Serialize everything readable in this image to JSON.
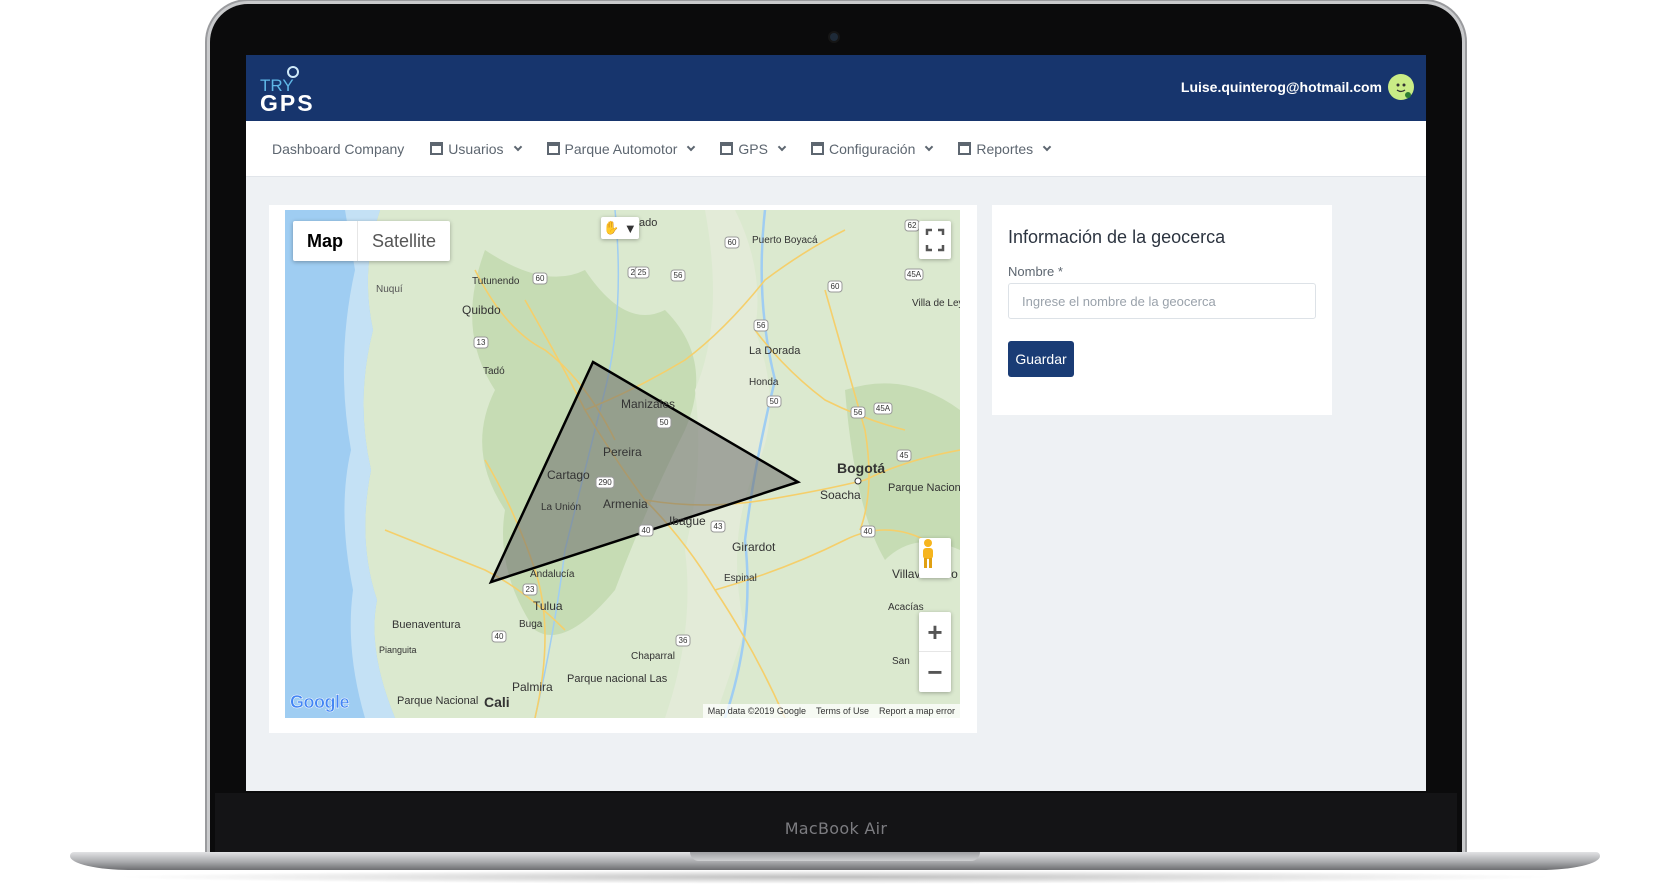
{
  "device": {
    "label": "MacBook Air"
  },
  "header": {
    "user_email": "Luise.quinterog@hotmail.com",
    "brand_color": "#17356d",
    "logo": {
      "line1": "TRY",
      "line2": "GPS"
    }
  },
  "nav": {
    "items": [
      {
        "label": "Dashboard Company",
        "icon": "none",
        "dropdown": false
      },
      {
        "label": "Usuarios",
        "icon": "table-icon",
        "dropdown": true
      },
      {
        "label": "Parque Automotor",
        "icon": "table-icon",
        "dropdown": true
      },
      {
        "label": "GPS",
        "icon": "table-icon",
        "dropdown": true
      },
      {
        "label": "Configuración",
        "icon": "table-icon",
        "dropdown": true
      },
      {
        "label": "Reportes",
        "icon": "table-icon",
        "dropdown": true
      }
    ]
  },
  "map": {
    "type_map": "Map",
    "type_satellite": "Satellite",
    "selected_type": "Map",
    "google": "Google",
    "attribution": {
      "data": "Map data ©2019 Google",
      "terms": "Terms of Use",
      "report": "Report a map error"
    },
    "places": {
      "nuqui": "Nuquí",
      "tutunendo": "Tutunendo",
      "quibdo": "Quibdo",
      "tado": "Tadó",
      "manizales": "Manizales",
      "pereira": "Pereira",
      "cartago": "Cartago",
      "armenia": "Armenia",
      "la_union": "La Unión",
      "ibague": "Ibague",
      "andalucia": "Andalucía",
      "tulua": "Tulua",
      "buga": "Buga",
      "buenaventura": "Buenaventura",
      "pianguita": "Pianguita",
      "palmira": "Palmira",
      "cali": "Cali",
      "parque_nacional_las": "Parque nacional Las",
      "parque_nacional": "Parque Nacional",
      "la_dorada": "La Dorada",
      "honda": "Honda",
      "puerto_boyaca": "Puerto Boyacá",
      "bogota": "Bogotá",
      "soacha": "Soacha",
      "chingaza": "Parque Nacional Natural Chingaza",
      "girardot": "Girardot",
      "espinal": "Espinal",
      "chaparral": "Chaparral",
      "villavicencio": "Villavicencio",
      "acacias": "Acacías",
      "san": "San",
      "villa_de_ley": "Villa de Ley",
      "ado": "ado"
    },
    "roads": [
      "60",
      "25",
      "56",
      "60",
      "60",
      "45A",
      "13",
      "56",
      "50",
      "50",
      "56",
      "45A",
      "290",
      "45",
      "43",
      "40",
      "23",
      "40",
      "36",
      "25",
      "62",
      "40"
    ]
  },
  "form": {
    "title": "Información de la geocerca",
    "name_label": "Nombre *",
    "name_placeholder": "Ingrese el nombre de la geocerca",
    "name_value": "",
    "save_label": "Guardar"
  }
}
